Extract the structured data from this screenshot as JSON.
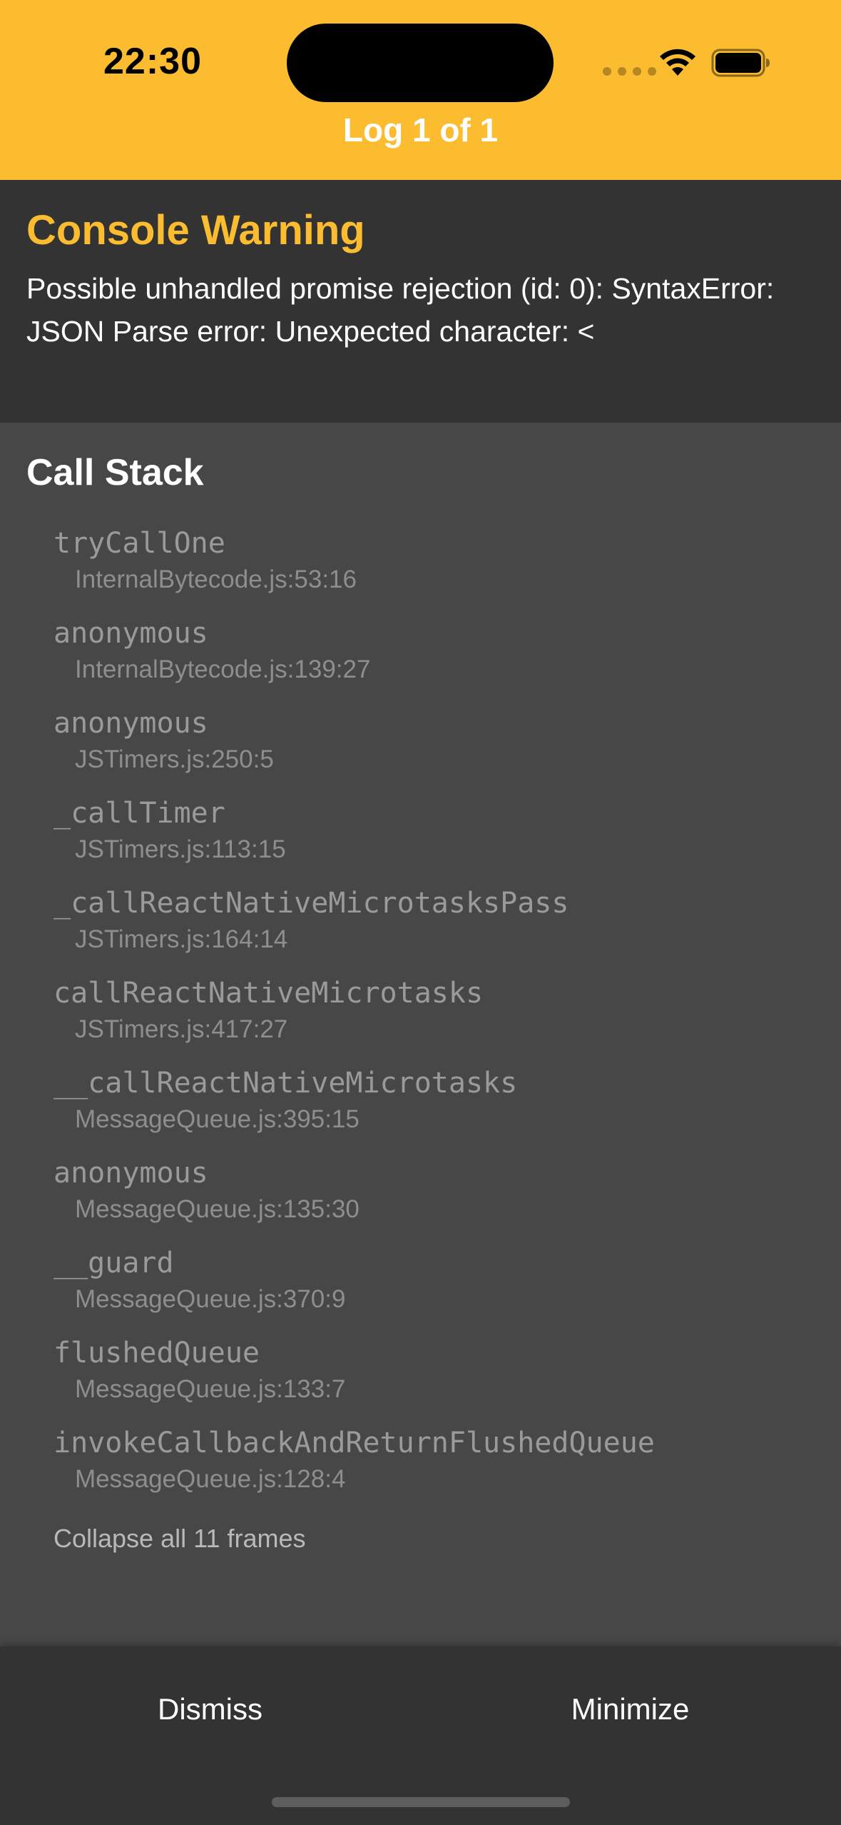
{
  "status_bar": {
    "time": "22:30"
  },
  "header": {
    "title": "Log 1 of 1",
    "background_color": "#FBBC30"
  },
  "message": {
    "title": "Console Warning",
    "text": "Possible unhandled promise rejection (id: 0): SyntaxError: JSON Parse error: Unexpected character: <"
  },
  "call_stack": {
    "heading": "Call Stack",
    "frames": [
      {
        "name": "tryCallOne",
        "location": "InternalBytecode.js:53:16"
      },
      {
        "name": "anonymous",
        "location": "InternalBytecode.js:139:27"
      },
      {
        "name": "anonymous",
        "location": "JSTimers.js:250:5"
      },
      {
        "name": "_callTimer",
        "location": "JSTimers.js:113:15"
      },
      {
        "name": "_callReactNativeMicrotasksPass",
        "location": "JSTimers.js:164:14"
      },
      {
        "name": "callReactNativeMicrotasks",
        "location": "JSTimers.js:417:27"
      },
      {
        "name": "__callReactNativeMicrotasks",
        "location": "MessageQueue.js:395:15"
      },
      {
        "name": "anonymous",
        "location": "MessageQueue.js:135:30"
      },
      {
        "name": "__guard",
        "location": "MessageQueue.js:370:9"
      },
      {
        "name": "flushedQueue",
        "location": "MessageQueue.js:133:7"
      },
      {
        "name": "invokeCallbackAndReturnFlushedQueue",
        "location": "MessageQueue.js:128:4"
      }
    ],
    "collapse_label": "Collapse all 11 frames"
  },
  "footer": {
    "dismiss_label": "Dismiss",
    "minimize_label": "Minimize"
  },
  "icons": [
    "wifi-icon",
    "battery-icon",
    "signal-dots-icon"
  ]
}
